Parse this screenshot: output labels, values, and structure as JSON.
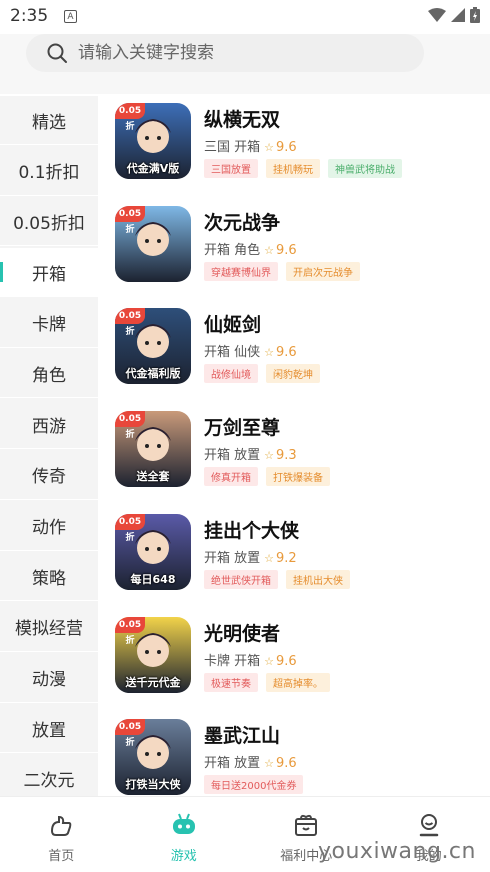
{
  "status_bar": {
    "time": "2:35",
    "notif_glyph": "A"
  },
  "search": {
    "placeholder": "请输入关键字搜索"
  },
  "categories": [
    {
      "label": "精选",
      "active": false
    },
    {
      "label": "0.1折扣",
      "active": false
    },
    {
      "label": "0.05折扣",
      "active": false
    },
    {
      "label": "开箱",
      "active": true
    },
    {
      "label": "卡牌",
      "active": false
    },
    {
      "label": "角色",
      "active": false
    },
    {
      "label": "西游",
      "active": false
    },
    {
      "label": "传奇",
      "active": false
    },
    {
      "label": "动作",
      "active": false
    },
    {
      "label": "策略",
      "active": false
    },
    {
      "label": "模拟经营",
      "active": false
    },
    {
      "label": "动漫",
      "active": false
    },
    {
      "label": "放置",
      "active": false
    },
    {
      "label": "二次元",
      "active": false
    }
  ],
  "games": [
    {
      "name": "纵横无双",
      "badge": "0.05折",
      "genre": "三国 开箱",
      "rating": "9.6",
      "icon_text": "代金满V版",
      "tags": [
        {
          "text": "三国放置",
          "tone": "red"
        },
        {
          "text": "挂机畅玩",
          "tone": "orange"
        },
        {
          "text": "神兽武将助战",
          "tone": "green"
        }
      ]
    },
    {
      "name": "次元战争",
      "badge": "0.05折",
      "genre": "开箱 角色",
      "rating": "9.6",
      "icon_text": "",
      "tags": [
        {
          "text": "穿越赛博仙界",
          "tone": "red"
        },
        {
          "text": "开启次元战争",
          "tone": "orange"
        }
      ]
    },
    {
      "name": "仙姬剑",
      "badge": "0.05折",
      "genre": "开箱 仙侠",
      "rating": "9.6",
      "icon_text": "代金福利版",
      "tags": [
        {
          "text": "战修仙境",
          "tone": "red"
        },
        {
          "text": "闲豹乾坤",
          "tone": "orange"
        }
      ]
    },
    {
      "name": "万剑至尊",
      "badge": "0.05折",
      "genre": "开箱 放置",
      "rating": "9.3",
      "icon_text": "送全套",
      "tags": [
        {
          "text": "修真开箱",
          "tone": "red"
        },
        {
          "text": "打铁爆装备",
          "tone": "orange"
        }
      ]
    },
    {
      "name": "挂出个大侠",
      "badge": "0.05折",
      "genre": "开箱 放置",
      "rating": "9.2",
      "icon_text": "每日648",
      "tags": [
        {
          "text": "绝世武侠开箱",
          "tone": "red"
        },
        {
          "text": "挂机出大侠",
          "tone": "orange"
        }
      ]
    },
    {
      "name": "光明使者",
      "badge": "0.05折",
      "genre": "卡牌 开箱",
      "rating": "9.6",
      "icon_text": "送千元代金",
      "tags": [
        {
          "text": "极速节奏",
          "tone": "red"
        },
        {
          "text": "超高掉率。",
          "tone": "orange"
        }
      ]
    },
    {
      "name": "墨武江山",
      "badge": "0.05折",
      "genre": "开箱 放置",
      "rating": "9.6",
      "icon_text": "打铁当大侠",
      "tags": [
        {
          "text": "每日送2000代金券",
          "tone": "red"
        }
      ]
    }
  ],
  "icon_colors": [
    "#3d6fb8",
    "#7fb8e6",
    "#2e4f7a",
    "#c99a7a",
    "#5a5aa8",
    "#f2d34a",
    "#6a7e9a"
  ],
  "bottom_nav": [
    {
      "label": "首页",
      "icon": "home-icon",
      "active": false
    },
    {
      "label": "游戏",
      "icon": "gamepad-icon",
      "active": true
    },
    {
      "label": "福利中心",
      "icon": "gift-icon",
      "active": false
    },
    {
      "label": "我的",
      "icon": "user-icon",
      "active": false
    }
  ],
  "watermark": "youxiwang.cn",
  "accent_color": "#27c2b0"
}
